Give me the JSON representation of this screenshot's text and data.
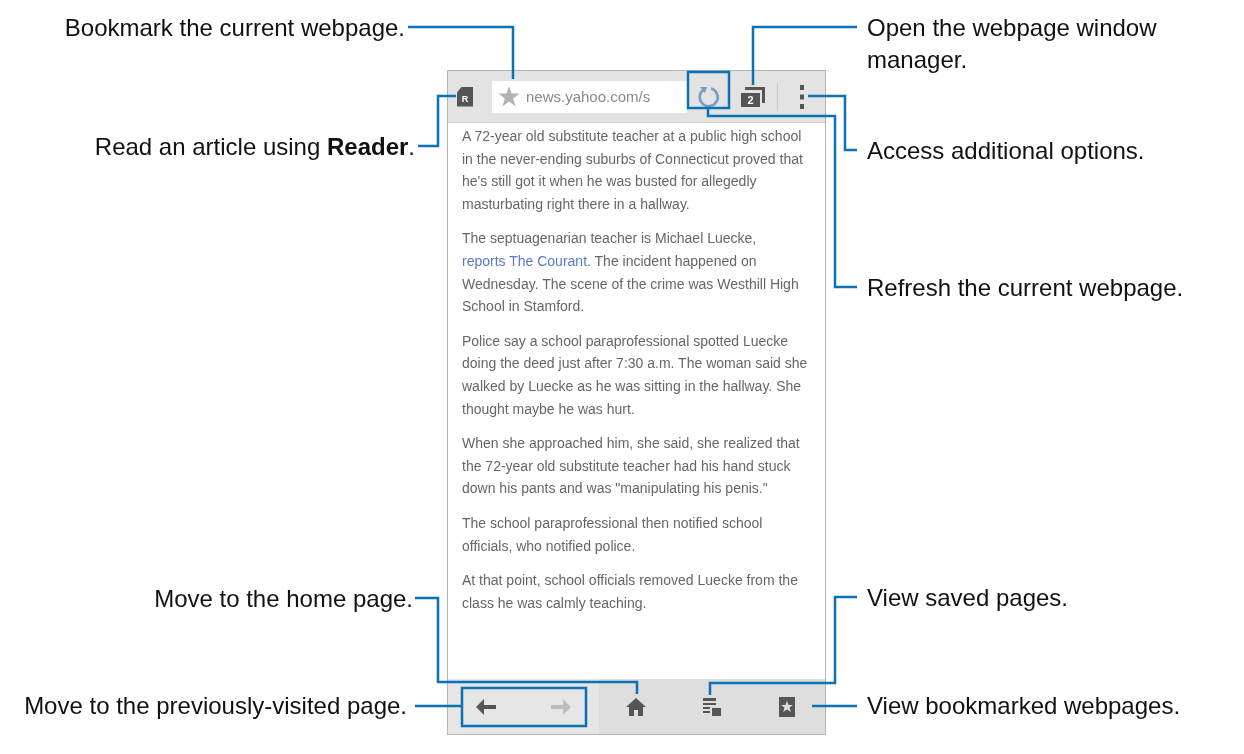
{
  "callouts": [
    {
      "text": "Bookmark the current webpage."
    },
    {
      "text": "Read an article using **Reader**."
    },
    {
      "text": "Move to the home page."
    },
    {
      "text": "Move to the previously-visited page."
    },
    {
      "text": "Open the webpage window manager."
    },
    {
      "text": "Access additional options."
    },
    {
      "text": "Refresh the current webpage."
    },
    {
      "text": "View saved pages."
    },
    {
      "text": "View bookmarked webpages."
    }
  ],
  "browser": {
    "reader_letter": "R",
    "url": "news.yahoo.com/s",
    "tab_count": "2",
    "article": [
      {
        "text": "A 72-year old substitute teacher at a public high school in the never-ending suburbs of Connecticut proved that he's still got it when he was busted for allegedly masturbating right there in a hallway."
      },
      {
        "text": "The septuagenarian teacher is Michael Luecke,",
        "link": "reports The Courant",
        "after": ". The incident happened on Wednesday. The scene of the crime was Westhill High School in Stamford."
      },
      {
        "text": "Police say a school paraprofessional spotted Luecke doing the deed just after 7:30 a.m. The woman said she walked by Luecke as he was sitting in the hallway. She thought maybe he was hurt."
      },
      {
        "text": "When she approached him, she said, she realized that the 72-year old substitute teacher had his hand stuck down his pants and was \"manipulating his penis.\""
      },
      {
        "text": "The school paraprofessional then notified school officials, who notified police."
      },
      {
        "text": "At that point, school officials removed Luecke from the class he was calmly teaching."
      }
    ],
    "bottom_bar": [
      {
        "kind": "back",
        "disabled": false
      },
      {
        "kind": "forward",
        "disabled": true
      },
      {
        "kind": "home",
        "disabled": false
      },
      {
        "kind": "saved",
        "disabled": false
      },
      {
        "kind": "bookmarks",
        "disabled": false
      }
    ]
  }
}
